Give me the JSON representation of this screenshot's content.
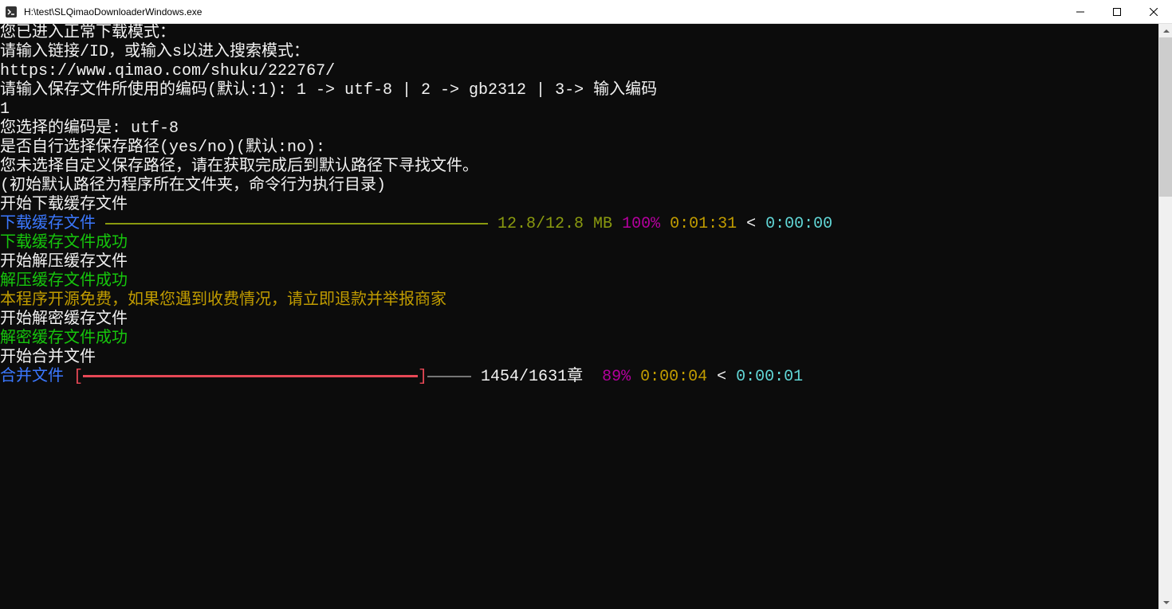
{
  "window": {
    "title": "H:\\test\\SLQimaoDownloaderWindows.exe"
  },
  "terminal": {
    "lines": {
      "mode_entered": "您已进入正常下载模式：",
      "prompt_input": "请输入链接/ID，或输入s以进入搜索模式：",
      "url": "https://www.qimao.com/shuku/222767/",
      "prompt_encoding": "请输入保存文件所使用的编码(默认:1): 1 -> utf-8 | 2 -> gb2312 | 3-> 输入编码",
      "user_input_1": "1",
      "encoding_selected": "您选择的编码是: utf-8",
      "prompt_path": "是否自行选择保存路径(yes/no)(默认:no):",
      "no_custom_path": "您未选择自定义保存路径，请在获取完成后到默认路径下寻找文件。",
      "default_path_note": "(初始默认路径为程序所在文件夹，命令行为执行目录)",
      "start_download_cache": "开始下载缓存文件",
      "download_label": "下载缓存文件 ",
      "download_size": "12.8/12.8 MB",
      "download_percent": "100%",
      "download_elapsed": "0:01:31",
      "download_separator": " < ",
      "download_remaining": "0:00:00",
      "download_success": "下载缓存文件成功",
      "start_extract": "开始解压缓存文件",
      "extract_success": "解压缓存文件成功",
      "opensource_notice": "本程序开源免费，如果您遇到收费情况，请立即退款并举报商家",
      "start_decrypt": "开始解密缓存文件",
      "decrypt_success": "解密缓存文件成功",
      "start_merge": "开始合并文件",
      "merge_label": "合并文件 ",
      "merge_bracket_open": "[",
      "merge_bracket_close": "]",
      "merge_count": " 1454/1631章 ",
      "merge_percent": " 89%",
      "merge_elapsed": " 0:00:04",
      "merge_separator": " < ",
      "merge_remaining": "0:00:01"
    }
  }
}
